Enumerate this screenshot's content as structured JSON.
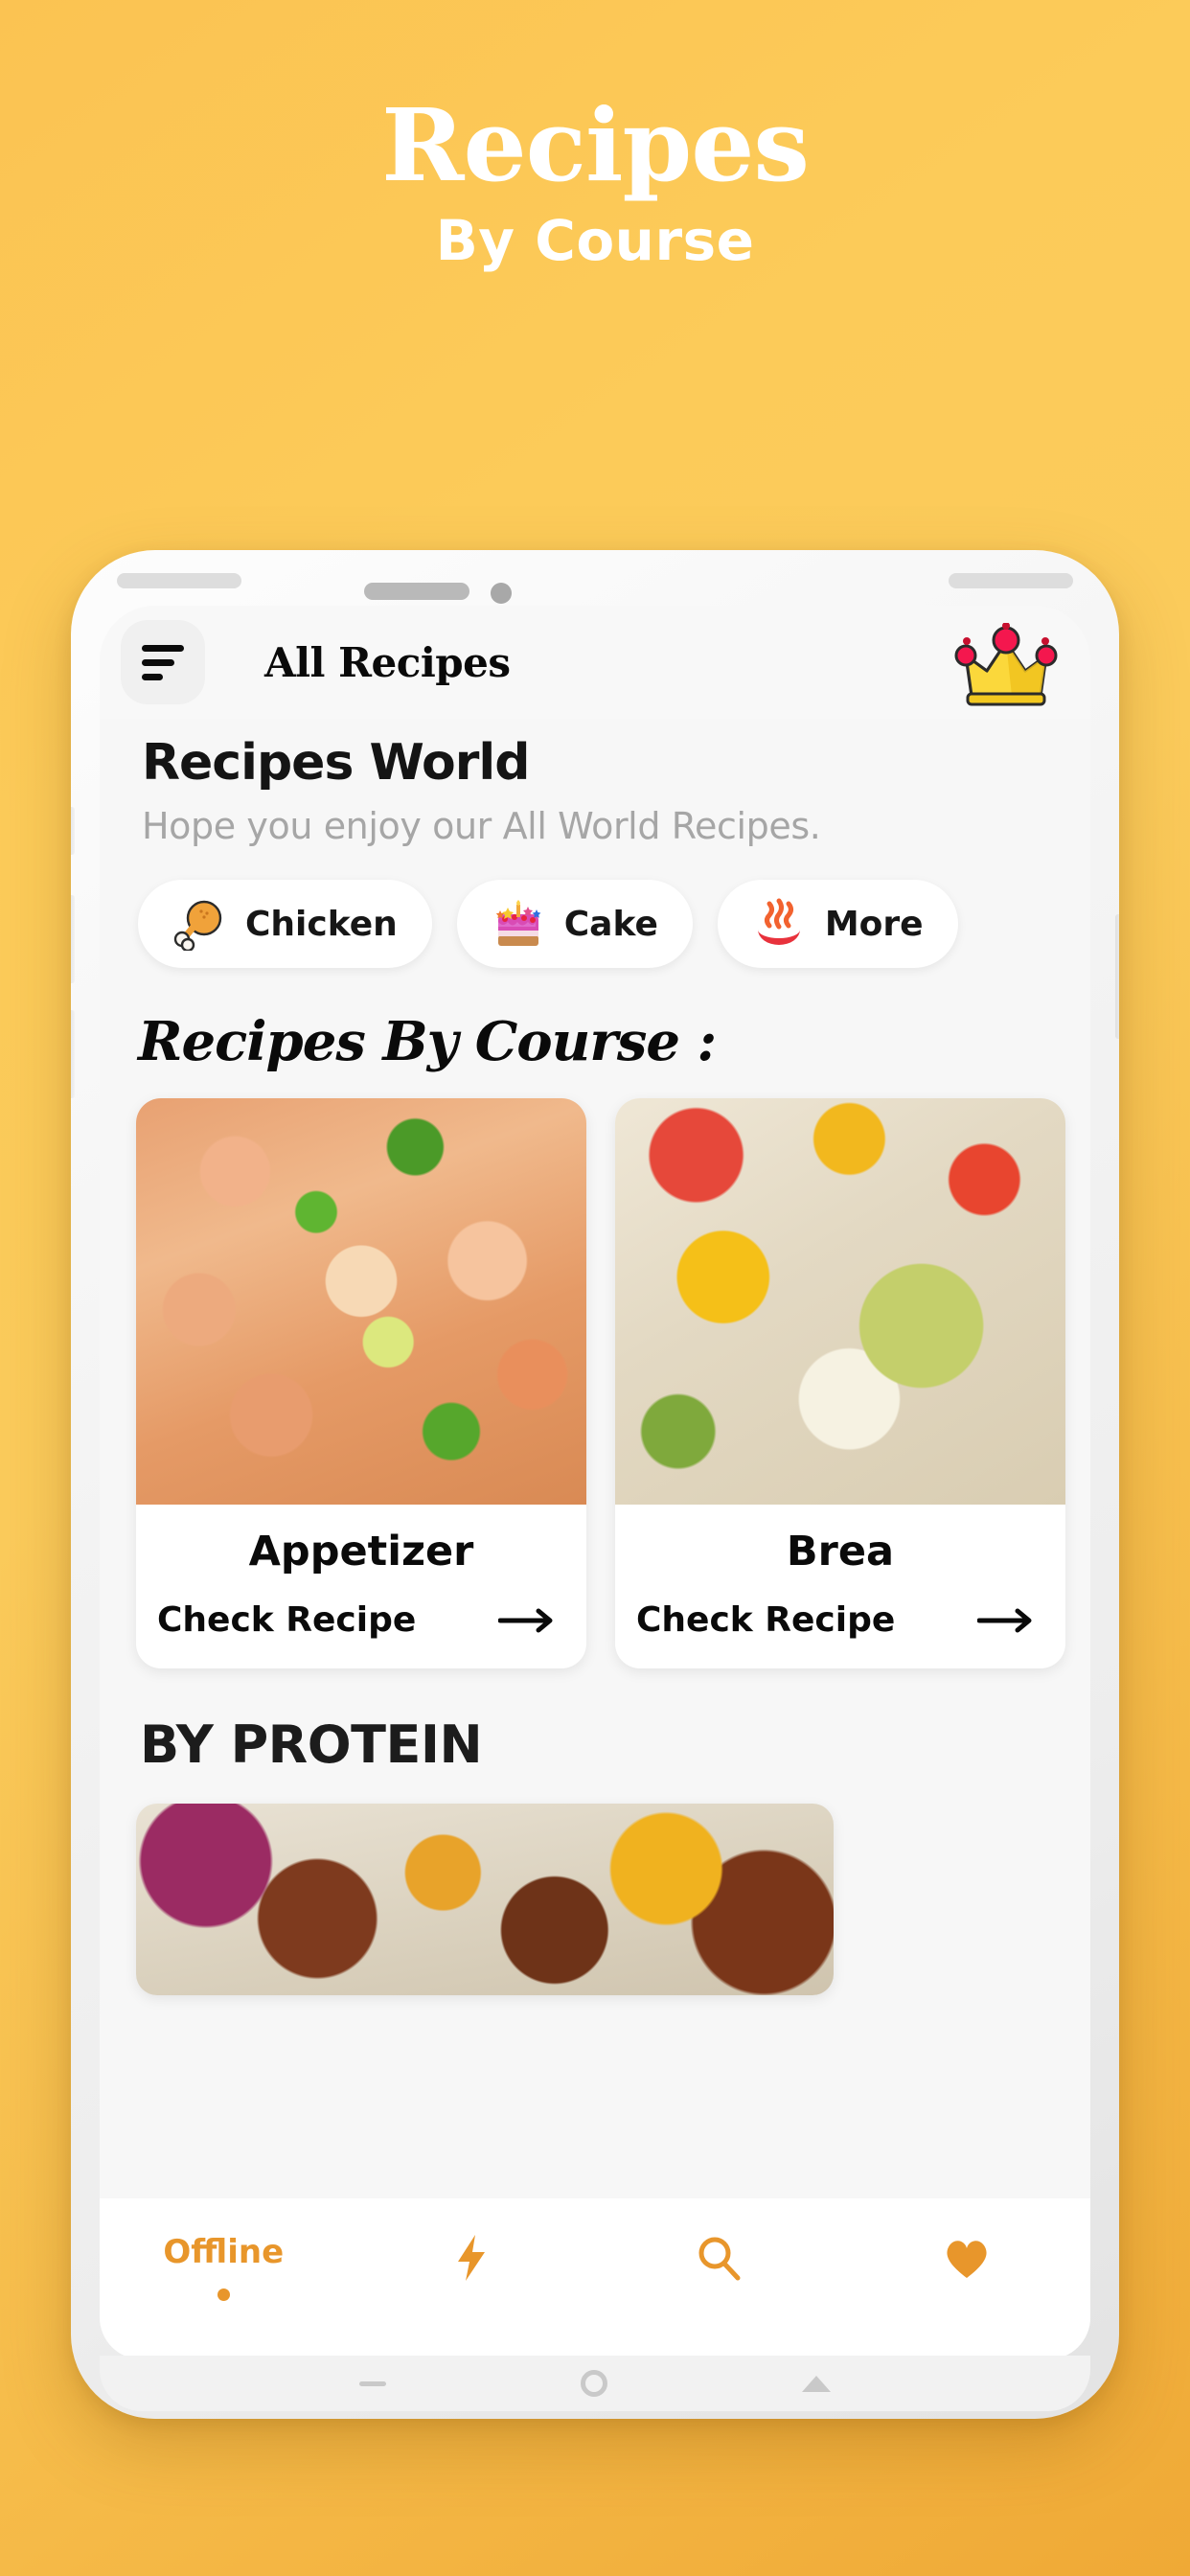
{
  "promo": {
    "title": "Recipes",
    "subtitle": "By Course",
    "background_start": "#FBC352",
    "background_end": "#EFA936"
  },
  "phone": {
    "appbar": {
      "menu_icon": "hamburger-menu-icon",
      "title": "All Recipes",
      "premium_icon": "crown-icon"
    },
    "brand": {
      "title": "Recipes World",
      "subtitle": "Hope you enjoy our All World Recipes."
    },
    "chips": [
      {
        "label": "Chicken",
        "icon": "poultry-leg-icon"
      },
      {
        "label": "Cake",
        "icon": "birthday-cake-icon"
      },
      {
        "label": "More",
        "icon": "hot-springs-icon"
      }
    ],
    "course_section": {
      "heading": "Recipes By Course :",
      "cards": [
        {
          "name": "Appetizer",
          "cta": "Check Recipe",
          "cta_icon": "arrow-right-icon",
          "image": "grilled-shrimp-with-lime-and-jalapeno"
        },
        {
          "name": "Brea",
          "cta": "Check Recipe",
          "cta_icon": "arrow-right-icon",
          "image": "avocado-toast-with-egg-and-tomatoes"
        }
      ]
    },
    "protein_section": {
      "heading": "BY PROTEIN",
      "image": "beef-skewers-with-peppers-and-onion"
    },
    "bottom_nav": [
      {
        "type": "label",
        "label": "Offline",
        "active": true,
        "icon": ""
      },
      {
        "type": "icon",
        "label": "",
        "active": false,
        "icon": "lightning-bolt-icon"
      },
      {
        "type": "icon",
        "label": "",
        "active": false,
        "icon": "search-icon"
      },
      {
        "type": "icon",
        "label": "",
        "active": false,
        "icon": "heart-icon"
      }
    ],
    "accent_color": "#E8962B"
  }
}
